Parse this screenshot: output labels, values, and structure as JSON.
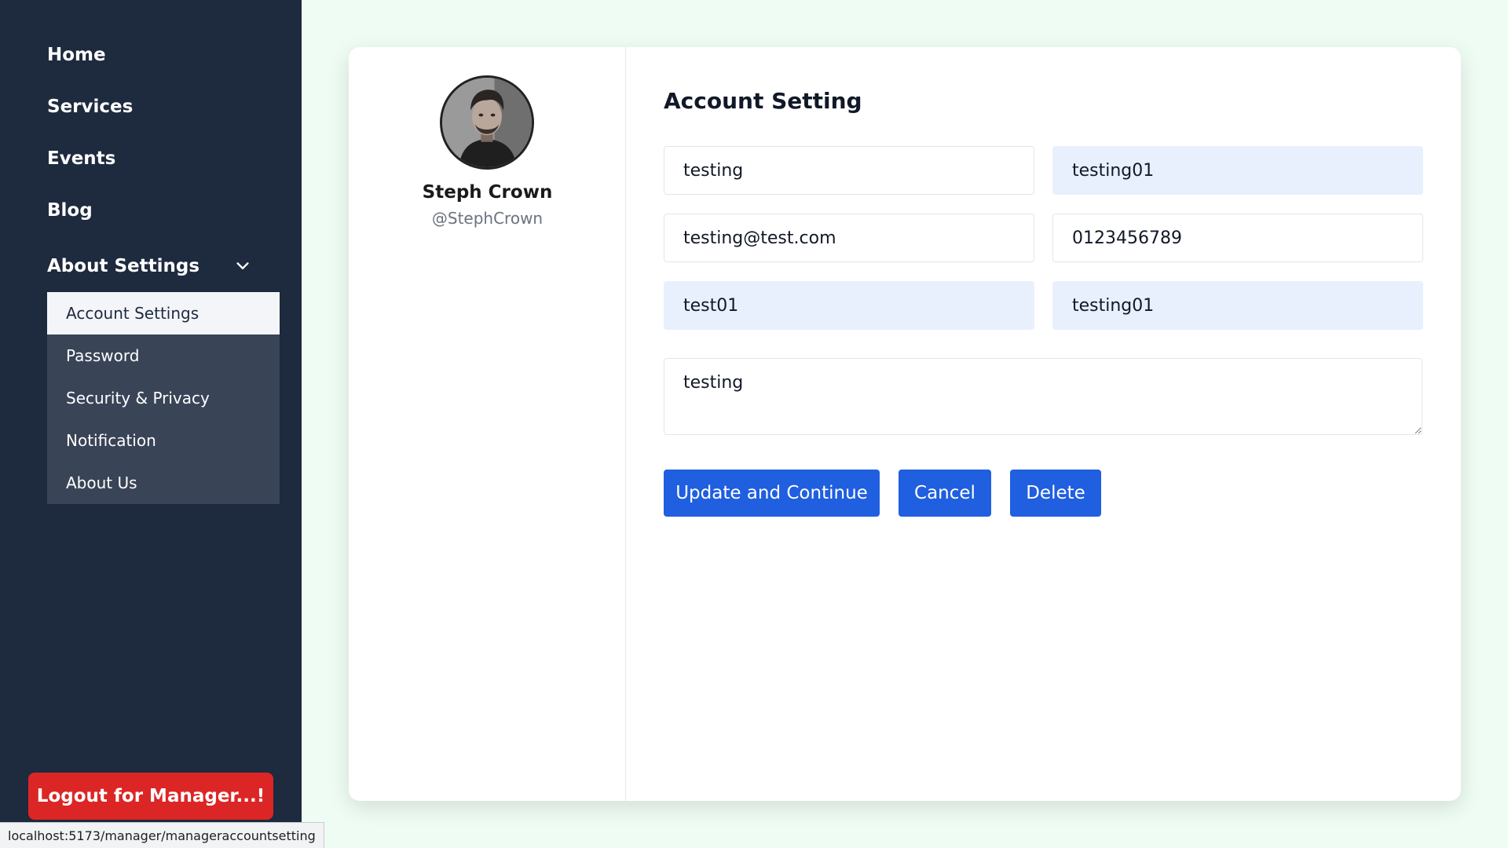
{
  "sidebar": {
    "nav": [
      {
        "label": "Home"
      },
      {
        "label": "Services"
      },
      {
        "label": "Events"
      },
      {
        "label": "Blog"
      }
    ],
    "about_settings": {
      "label": "About Settings",
      "expanded": true,
      "items": [
        {
          "label": "Account Settings",
          "active": true
        },
        {
          "label": "Password",
          "active": false
        },
        {
          "label": "Security & Privacy",
          "active": false
        },
        {
          "label": "Notification",
          "active": false
        },
        {
          "label": "About Us",
          "active": false
        }
      ]
    },
    "logout_label": "Logout for Manager...!"
  },
  "profile": {
    "name": "Steph Crown",
    "handle": "@StephCrown"
  },
  "form": {
    "title": "Account Setting",
    "fields": [
      {
        "value": "testing"
      },
      {
        "value": "testing01"
      },
      {
        "value": "testing@test.com"
      },
      {
        "value": "0123456789"
      },
      {
        "value": "test01"
      },
      {
        "value": "testing01"
      }
    ],
    "textarea_value": "testing",
    "buttons": {
      "update": "Update and Continue",
      "cancel": "Cancel",
      "delete": "Delete"
    }
  },
  "status_bar": {
    "url": "localhost:5173/manager/manageraccountsetting"
  },
  "colors": {
    "sidebar_bg": "#1e2a3e",
    "submenu_bg": "#3a4457",
    "page_bg": "#effcf3",
    "primary_button": "#1f5fe0",
    "logout_button": "#dc2626",
    "autofill_field": "#e8f0fe"
  }
}
